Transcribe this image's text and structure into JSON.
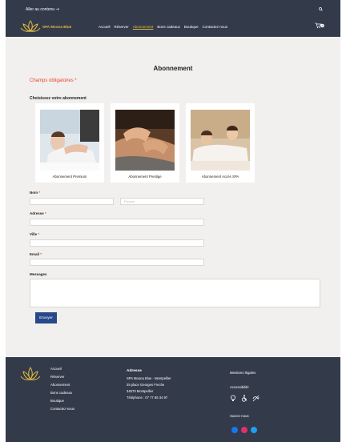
{
  "header": {
    "skip_link": "Aller au contenu ⇥",
    "brand": "SPA Moona Blue",
    "nav": [
      "Accueil",
      "Réserver",
      "Abonnement",
      "Bons cadeaux",
      "Boutique",
      "Contactez-nous"
    ],
    "active_nav": "Abonnement",
    "cart_count": "0"
  },
  "form": {
    "title": "Abonnement",
    "required_note": "Champs obligatoires *",
    "choose_label": "Choisissez votre abonnement",
    "options": [
      {
        "label": "Abonnement Premium",
        "icon": "spa-massage-photo"
      },
      {
        "label": "Abonnement Prestige",
        "icon": "spa-hands-photo"
      },
      {
        "label": "Abonnement Accès SPA",
        "icon": "spa-couple-photo"
      }
    ],
    "name_label": "Nom",
    "prenom_placeholder": "Prénom",
    "address_label": "Adresse",
    "city_label": "Ville",
    "email_label": "Email",
    "message_label": "Messages",
    "submit": "Envoyer"
  },
  "footer": {
    "nav": [
      "Accueil",
      "Réserver",
      "Abonnement",
      "Bons cadeaux",
      "Boutique",
      "Contactez-nous"
    ],
    "address_title": "Adresse",
    "address_lines": [
      "SPA Moona Blue - Montpellier",
      "25 place Georges Freche",
      "34070 Montpellier",
      "Téléphone : 07 77 86 34 97"
    ],
    "legal": "Mentions légales",
    "accessibility": "Accessibilité",
    "follow": "Suivez-nous"
  },
  "colors": {
    "navy": "#333a49",
    "gold": "#e2bb45",
    "red": "#e7432a",
    "button": "#27498a"
  }
}
